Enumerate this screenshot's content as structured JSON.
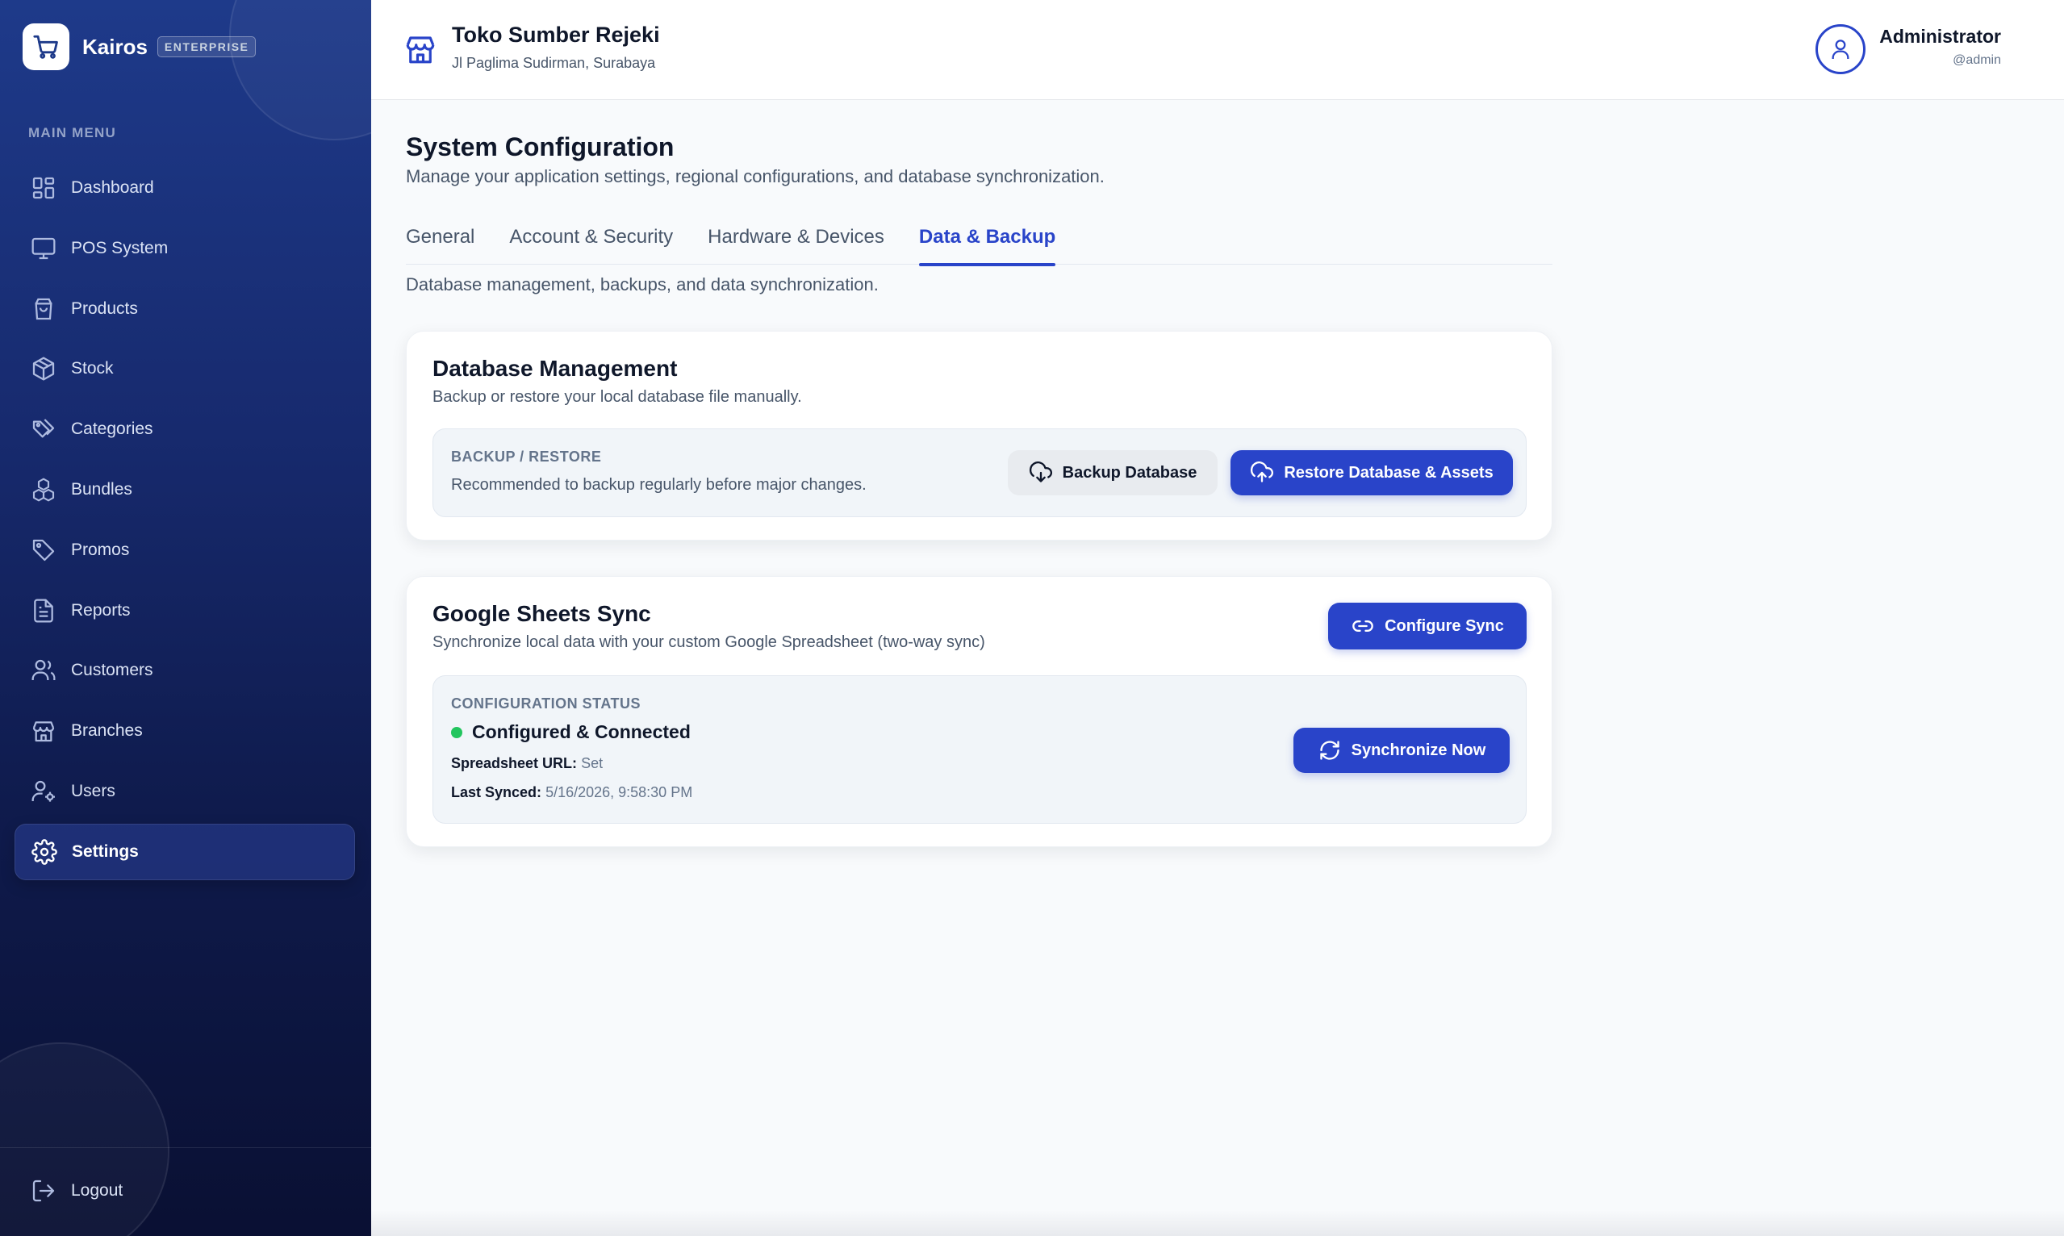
{
  "colors": {
    "accent": "#2944c9",
    "sidebar_top": "#1e3a8a",
    "sidebar_bottom": "#0a1033",
    "status_ok": "#22c55e"
  },
  "brand": {
    "name": "Kairos",
    "badge": "ENTERPRISE",
    "logo_icon": "shopping-cart-icon"
  },
  "sidebar": {
    "section_label": "MAIN MENU",
    "items": [
      {
        "label": "Dashboard",
        "icon": "dashboard-grid-icon"
      },
      {
        "label": "POS System",
        "icon": "monitor-icon"
      },
      {
        "label": "Products",
        "icon": "shopping-bag-icon"
      },
      {
        "label": "Stock",
        "icon": "package-box-icon"
      },
      {
        "label": "Categories",
        "icon": "tags-icon"
      },
      {
        "label": "Bundles",
        "icon": "boxes-icon"
      },
      {
        "label": "Promos",
        "icon": "tag-icon"
      },
      {
        "label": "Reports",
        "icon": "file-text-icon"
      },
      {
        "label": "Customers",
        "icon": "users-icon"
      },
      {
        "label": "Branches",
        "icon": "store-icon"
      },
      {
        "label": "Users",
        "icon": "user-cog-icon"
      },
      {
        "label": "Settings",
        "icon": "gear-icon",
        "active": true
      }
    ],
    "logout_label": "Logout"
  },
  "header": {
    "store_name": "Toko Sumber Rejeki",
    "store_address": "Jl Paglima Sudirman, Surabaya",
    "user_name": "Administrator",
    "user_handle": "@admin"
  },
  "page": {
    "title": "System Configuration",
    "subtitle": "Manage your application settings, regional configurations, and database synchronization.",
    "tabs": [
      {
        "label": "General"
      },
      {
        "label": "Account & Security"
      },
      {
        "label": "Hardware & Devices"
      },
      {
        "label": "Data & Backup",
        "active": true
      }
    ],
    "tab_description": "Database management, backups, and data synchronization."
  },
  "database_card": {
    "title": "Database Management",
    "subtitle": "Backup or restore your local database file manually.",
    "section_label": "BACKUP / RESTORE",
    "section_text": "Recommended to backup regularly before major changes.",
    "backup_button": "Backup Database",
    "restore_button": "Restore Database & Assets"
  },
  "sheets_card": {
    "title": "Google Sheets Sync",
    "subtitle": "Synchronize local data with your custom Google Spreadsheet (two-way sync)",
    "configure_button": "Configure Sync",
    "status_label": "CONFIGURATION STATUS",
    "status_text": "Configured & Connected",
    "spreadsheet_url_key": "Spreadsheet URL:",
    "spreadsheet_url_value": "Set",
    "last_synced_key": "Last Synced:",
    "last_synced_value": "5/16/2026, 9:58:30 PM",
    "sync_button": "Synchronize Now"
  }
}
